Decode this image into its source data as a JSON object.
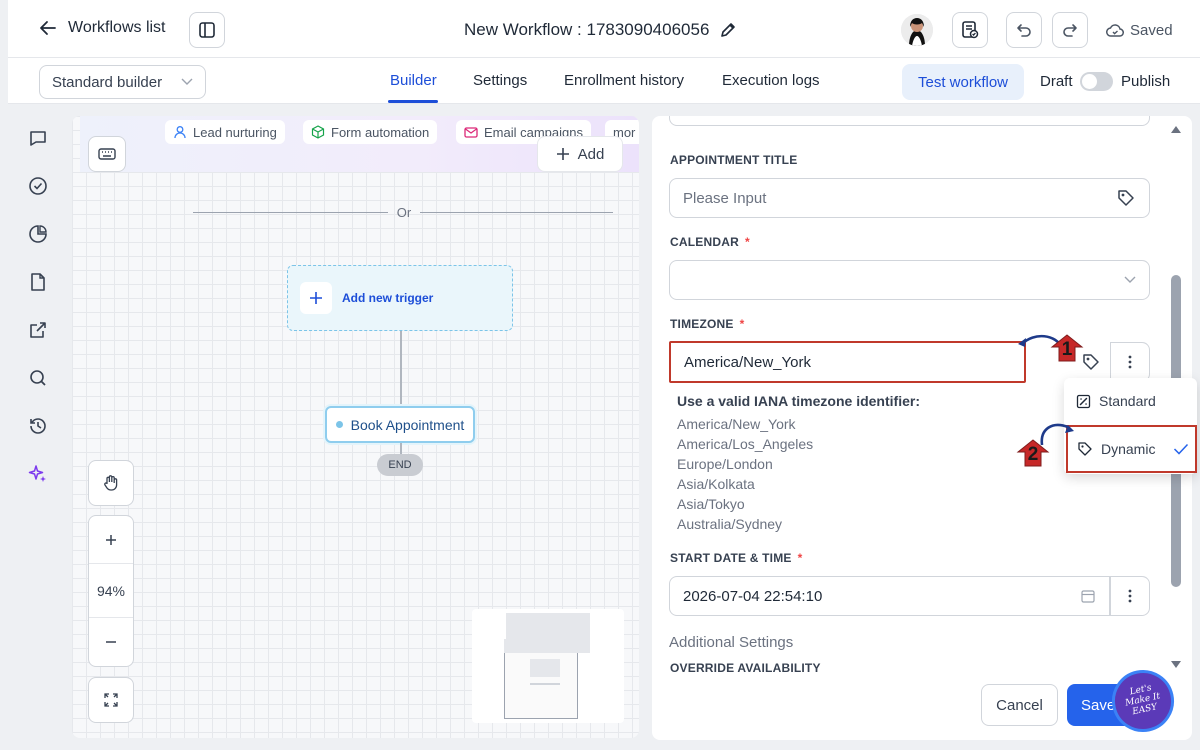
{
  "header": {
    "back_label": "Workflows list",
    "workflow_title": "New Workflow : 1783090406056",
    "saved_label": "Saved"
  },
  "subheader": {
    "builder_select": "Standard builder",
    "tabs": [
      "Builder",
      "Settings",
      "Enrollment history",
      "Execution logs"
    ],
    "test_workflow": "Test workflow",
    "draft_label": "Draft",
    "publish_label": "Publish"
  },
  "canvas": {
    "chips": [
      "Lead nurturing",
      "Form automation",
      "Email campaigns",
      "mor"
    ],
    "add_label": "Add",
    "or_label": "Or",
    "add_trigger": "Add new trigger",
    "action_node": "Book Appointment",
    "end_label": "END",
    "zoom": "94%"
  },
  "panel": {
    "appointment_title_label": "APPOINTMENT TITLE",
    "appointment_title_placeholder": "Please Input",
    "calendar_label": "CALENDAR",
    "timezone_label": "TIMEZONE",
    "timezone_value": "America/New_York",
    "hint_title": "Use a valid IANA timezone identifier:",
    "timezone_examples": [
      "America/New_York",
      "America/Los_Angeles",
      "Europe/London",
      "Asia/Kolkata",
      "Asia/Tokyo",
      "Australia/Sydney"
    ],
    "start_label": "START DATE & TIME",
    "start_value": "2026-07-04 22:54:10",
    "additional_settings": "Additional Settings",
    "override_label": "OVERRIDE AVAILABILITY",
    "required_mark": "*",
    "cancel_label": "Cancel",
    "save_label": "Save"
  },
  "dropdown": {
    "items": [
      "Standard",
      "Dynamic"
    ],
    "selected": "Dynamic"
  },
  "annotations": {
    "step1": "1",
    "step2": "2",
    "watermark_text": "Let's Make It EASY"
  },
  "colors": {
    "accent": "#1d4ed8",
    "save_button": "#2563eb",
    "highlight_box": "#c0392b",
    "trigger_border": "#7cc4e8",
    "sparkle": "#7c3aed"
  }
}
